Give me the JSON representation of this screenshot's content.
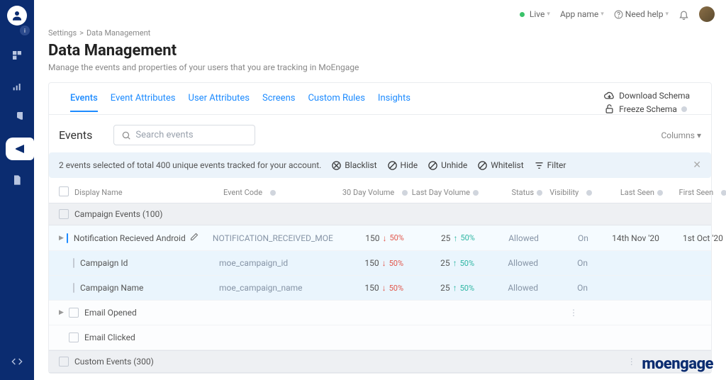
{
  "topbar": {
    "live": "Live",
    "app": "App name",
    "help": "Need help"
  },
  "breadcrumb": {
    "a": "Settings",
    "b": "Data Management"
  },
  "page": {
    "title": "Data Management",
    "desc": "Manage the events and properties of your users that you are tracking in MoEngage"
  },
  "tabs": {
    "events": "Events",
    "eventAttrs": "Event Attributes",
    "userAttrs": "User Attributes",
    "screens": "Screens",
    "customRules": "Custom Rules",
    "insights": "Insights"
  },
  "schema": {
    "download": "Download Schema",
    "freeze": "Freeze Schema"
  },
  "section": {
    "title": "Events",
    "searchPlaceholder": "Search events",
    "columns": "Columns"
  },
  "selectionBar": {
    "summary": "2 events selected of total 400 unique events tracked for your account.",
    "blacklist": "Blacklist",
    "hide": "Hide",
    "unhide": "Unhide",
    "whitelist": "Whitelist",
    "filter": "Filter"
  },
  "headers": {
    "displayName": "Display Name",
    "eventCode": "Event Code",
    "vol30": "30 Day Volume",
    "vol1": "Last Day Volume",
    "status": "Status",
    "visibility": "Visibility",
    "lastSeen": "Last Seen",
    "firstSeen": "First Seen"
  },
  "groups": {
    "campaign": "Campaign Events (100)",
    "custom": "Custom Events (300)"
  },
  "rows": {
    "r1": {
      "name": "Notification Recieved Android",
      "code": "NOTIFICATION_RECEIVED_MOE",
      "v30": "150",
      "v30pct": "50%",
      "v1": "25",
      "v1pct": "50%",
      "status": "Allowed",
      "vis": "On",
      "last": "14th Nov '20",
      "first": "1st Oct '20"
    },
    "r2": {
      "name": "Campaign Id",
      "code": "moe_campaign_id",
      "v30": "150",
      "v30pct": "50%",
      "v1": "25",
      "v1pct": "50%",
      "status": "Allowed",
      "vis": "On"
    },
    "r3": {
      "name": "Campaign Name",
      "code": "moe_campaign_name",
      "v30": "150",
      "v30pct": "50%",
      "v1": "25",
      "v1pct": "50%",
      "status": "Allowed",
      "vis": "On"
    },
    "r4": {
      "name": "Email Opened"
    },
    "r5": {
      "name": "Email Clicked"
    }
  },
  "brand": "moengage"
}
